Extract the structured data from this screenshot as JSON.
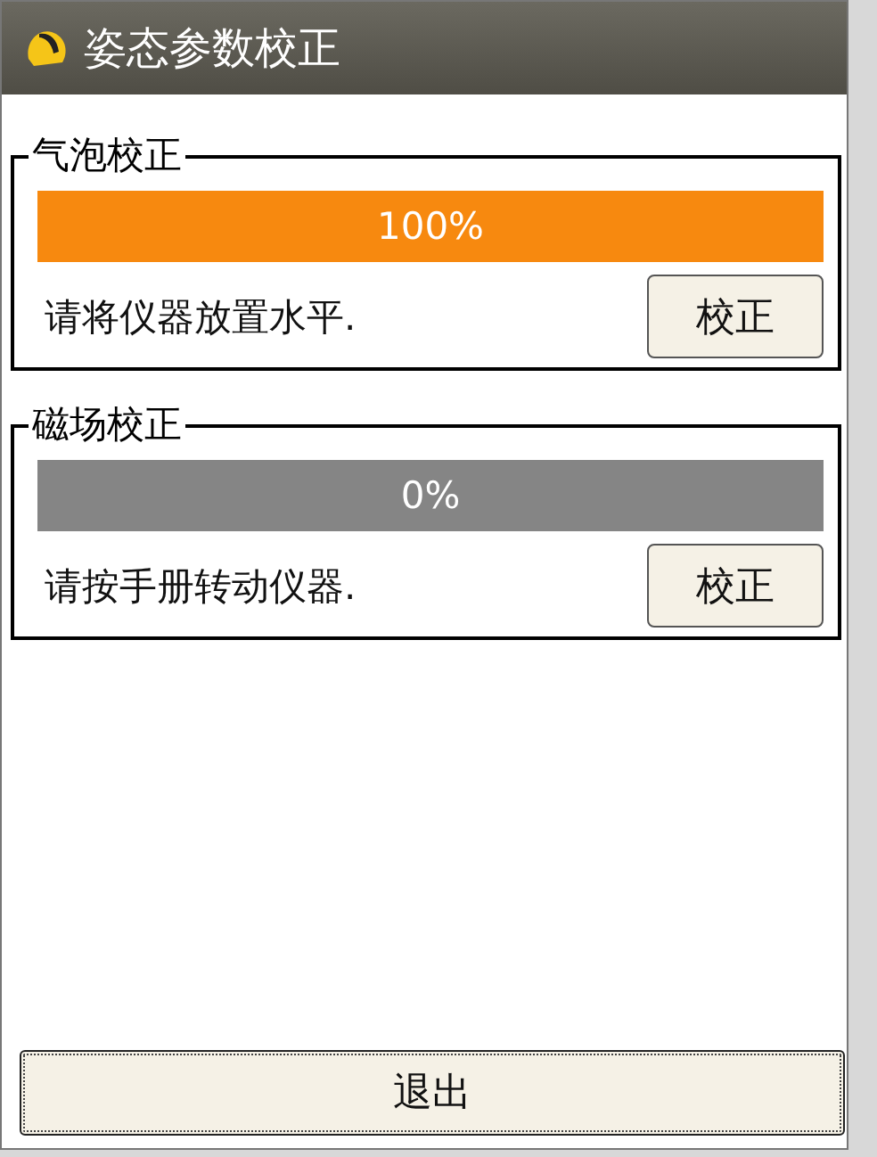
{
  "window": {
    "title": "姿态参数校正"
  },
  "groups": [
    {
      "title": "气泡校正",
      "level": 1.0,
      "reading": "100%",
      "message": "请将仪器放置水平.",
      "button": "校正"
    },
    {
      "title": "磁场校正",
      "level": 0.0,
      "reading": "0%",
      "message": "请按手册转动仪器.",
      "button": "校正"
    }
  ],
  "buttons": [
    "退出"
  ]
}
